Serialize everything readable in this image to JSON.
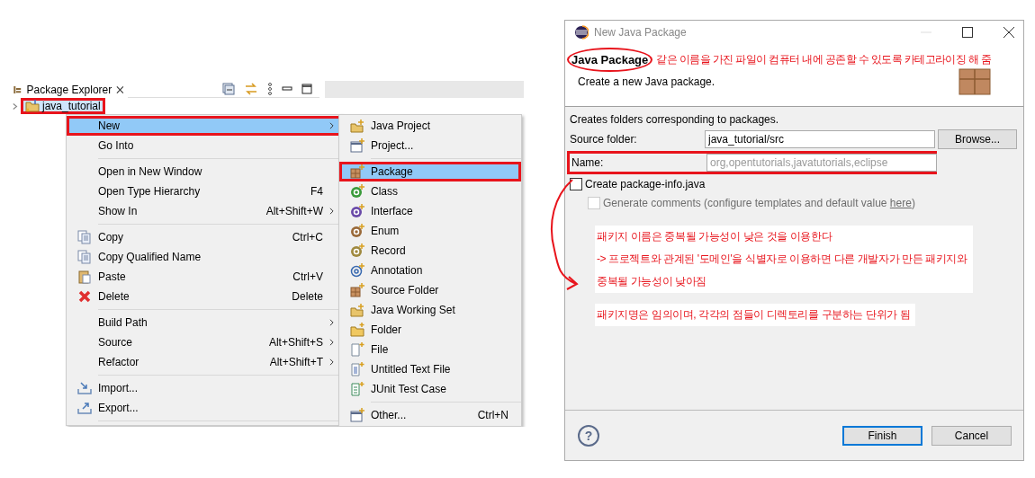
{
  "explorer": {
    "tab_title": "Package Explorer",
    "tree": [
      {
        "label": "java_tutorial",
        "expanded": false,
        "selected": true,
        "outlined": true
      }
    ]
  },
  "context_menu": {
    "items": [
      {
        "kind": "item",
        "label": "New",
        "has_submenu": true,
        "selected": true,
        "outlined": true
      },
      {
        "kind": "item",
        "label": "Go Into",
        "has_submenu": false,
        "selected": false,
        "outlined": false
      },
      {
        "kind": "separator"
      },
      {
        "kind": "item",
        "label": "Open in New Window",
        "has_submenu": false,
        "selected": false,
        "outlined": false
      },
      {
        "kind": "item",
        "label": "Open Type Hierarchy",
        "shortcut": "F4",
        "has_submenu": false,
        "selected": false,
        "outlined": false
      },
      {
        "kind": "item",
        "label": "Show In",
        "shortcut": "Alt+Shift+W",
        "has_submenu": true,
        "selected": false,
        "outlined": false
      },
      {
        "kind": "separator"
      },
      {
        "kind": "item",
        "label": "Copy",
        "shortcut": "Ctrl+C",
        "has_submenu": false,
        "selected": false,
        "outlined": false
      },
      {
        "kind": "item",
        "label": "Copy Qualified Name",
        "has_submenu": false,
        "selected": false,
        "outlined": false
      },
      {
        "kind": "item",
        "label": "Paste",
        "shortcut": "Ctrl+V",
        "has_submenu": false,
        "selected": false,
        "outlined": false
      },
      {
        "kind": "item",
        "label": "Delete",
        "shortcut": "Delete",
        "has_submenu": false,
        "selected": false,
        "outlined": false
      },
      {
        "kind": "separator"
      },
      {
        "kind": "item",
        "label": "Build Path",
        "has_submenu": true,
        "selected": false,
        "outlined": false
      },
      {
        "kind": "item",
        "label": "Source",
        "shortcut": "Alt+Shift+S",
        "has_submenu": true,
        "selected": false,
        "outlined": false
      },
      {
        "kind": "item",
        "label": "Refactor",
        "shortcut": "Alt+Shift+T",
        "has_submenu": true,
        "selected": false,
        "outlined": false
      },
      {
        "kind": "separator"
      },
      {
        "kind": "item",
        "label": "Import...",
        "has_submenu": false,
        "selected": false,
        "outlined": false
      },
      {
        "kind": "item",
        "label": "Export...",
        "has_submenu": false,
        "selected": false,
        "outlined": false
      },
      {
        "kind": "separator"
      }
    ]
  },
  "submenu": {
    "items": [
      {
        "kind": "item",
        "label": "Java Project",
        "has_submenu": false,
        "selected": false,
        "outlined": false
      },
      {
        "kind": "item",
        "label": "Project...",
        "has_submenu": false,
        "selected": false,
        "outlined": false
      },
      {
        "kind": "separator"
      },
      {
        "kind": "item",
        "label": "Package",
        "has_submenu": false,
        "selected": true,
        "outlined": true
      },
      {
        "kind": "item",
        "label": "Class",
        "has_submenu": false,
        "selected": false,
        "outlined": false
      },
      {
        "kind": "item",
        "label": "Interface",
        "has_submenu": false,
        "selected": false,
        "outlined": false
      },
      {
        "kind": "item",
        "label": "Enum",
        "has_submenu": false,
        "selected": false,
        "outlined": false
      },
      {
        "kind": "item",
        "label": "Record",
        "has_submenu": false,
        "selected": false,
        "outlined": false
      },
      {
        "kind": "item",
        "label": "Annotation",
        "has_submenu": false,
        "selected": false,
        "outlined": false
      },
      {
        "kind": "item",
        "label": "Source Folder",
        "has_submenu": false,
        "selected": false,
        "outlined": false
      },
      {
        "kind": "item",
        "label": "Java Working Set",
        "has_submenu": false,
        "selected": false,
        "outlined": false
      },
      {
        "kind": "item",
        "label": "Folder",
        "has_submenu": false,
        "selected": false,
        "outlined": false
      },
      {
        "kind": "item",
        "label": "File",
        "has_submenu": false,
        "selected": false,
        "outlined": false
      },
      {
        "kind": "item",
        "label": "Untitled Text File",
        "has_submenu": false,
        "selected": false,
        "outlined": false
      },
      {
        "kind": "item",
        "label": "JUnit Test Case",
        "has_submenu": false,
        "selected": false,
        "outlined": false
      },
      {
        "kind": "separator"
      },
      {
        "kind": "item",
        "label": "Other...",
        "shortcut": "Ctrl+N",
        "has_submenu": false,
        "selected": false,
        "outlined": false
      }
    ]
  },
  "dialog": {
    "title": "New Java Package",
    "heading": "Java Package",
    "heading_circled": true,
    "header_note": "같은 이름을 가진 파일이 컴퓨터 내에 공존할 수 있도록 카테고라이징 해 줌",
    "description": "Create a new Java package.",
    "intro": "Creates folders corresponding to packages.",
    "fields": [
      {
        "label": "Source folder:",
        "value": "java_tutorial/src",
        "button": "Browse...",
        "outlined": false
      },
      {
        "label": "Name:",
        "placeholder": "org,opentutorials,javatutorials,eclipse",
        "outlined": true
      }
    ],
    "checkboxes": [
      {
        "label": "Create package-info.java",
        "checked": false,
        "disabled": false
      },
      {
        "label": "Generate comments (configure templates and default value ",
        "link": "here",
        "label_end": ")",
        "checked": false,
        "disabled": true
      }
    ],
    "notes": [
      "패키지 이름은 중복될 가능성이 낮은 것을 이용한다\n-> 프로젝트와 관계된 '도메인'을 식별자로 이용하면 다른 개발자가 만든 패키지와\n중복될 가능성이 낮아짐",
      "패키지명은 임의이며, 각각의 점들이 디렉토리를 구분하는 단위가 됨"
    ],
    "help": "?",
    "buttons": [
      {
        "label": "Finish",
        "default": true
      },
      {
        "label": "Cancel",
        "default": false
      }
    ]
  }
}
